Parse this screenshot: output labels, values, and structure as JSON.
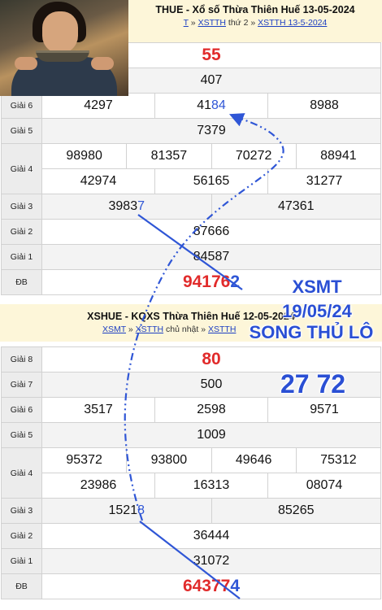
{
  "top": {
    "header": {
      "title": "THUE - Xổ số Thừa Thiên Huế 13-05-2024",
      "crumbs": [
        "T",
        "XSTTH",
        "thứ 2",
        "XSTTH 13-5-2024"
      ]
    },
    "rows": [
      {
        "label": "",
        "values": [
          "55"
        ]
      },
      {
        "label": "",
        "values": [
          "407"
        ]
      },
      {
        "label": "Giải 6",
        "values": [
          "4297",
          "4184",
          "8988"
        ]
      },
      {
        "label": "Giải 5",
        "values": [
          "7379"
        ]
      },
      {
        "label": "Giải 4",
        "values": [
          "98980",
          "81357",
          "70272",
          "88941",
          "42974",
          "56165",
          "31277"
        ]
      },
      {
        "label": "Giải 3",
        "values": [
          "39837",
          "47361"
        ]
      },
      {
        "label": "Giải 2",
        "values": [
          "87666"
        ]
      },
      {
        "label": "Giải 1",
        "values": [
          "84587"
        ]
      },
      {
        "label": "ĐB",
        "values": [
          "941762"
        ]
      }
    ]
  },
  "bottom": {
    "header": {
      "title": "XSHUE - KQXS Thừa Thiên Huế 12-05-2024",
      "crumbs": [
        "XSMT",
        "XSTTH",
        "chủ nhật",
        "XSTTH"
      ]
    },
    "rows": [
      {
        "label": "Giải 8",
        "values": [
          "80"
        ]
      },
      {
        "label": "Giải 7",
        "values": [
          "500"
        ]
      },
      {
        "label": "Giải 6",
        "values": [
          "3517",
          "2598",
          "9571"
        ]
      },
      {
        "label": "Giải 5",
        "values": [
          "1009"
        ]
      },
      {
        "label": "Giải 4",
        "values": [
          "95372",
          "93800",
          "49646",
          "75312",
          "23986",
          "16313",
          "08074"
        ]
      },
      {
        "label": "Giải 3",
        "values": [
          "15218",
          "85265"
        ]
      },
      {
        "label": "Giải 2",
        "values": [
          "36444"
        ]
      },
      {
        "label": "Giải 1",
        "values": [
          "31072"
        ]
      },
      {
        "label": "ĐB",
        "values": [
          "643774"
        ]
      }
    ]
  },
  "promo": {
    "line1": "XSMT",
    "line2": "19/05/24",
    "line3": "SONG THỦ LÔ",
    "numbers": "27 72"
  },
  "colors": {
    "accent": "#2f56d6",
    "prize_red": "#e12b2b",
    "header_bg": "#fdf6d9"
  }
}
